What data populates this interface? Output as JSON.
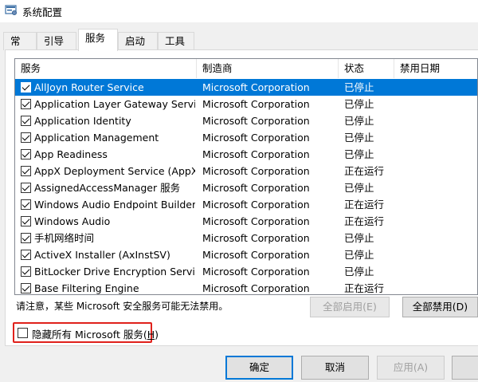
{
  "window": {
    "title": "系统配置"
  },
  "tabs": [
    {
      "label": "常规"
    },
    {
      "label": "引导"
    },
    {
      "label": "服务"
    },
    {
      "label": "启动"
    },
    {
      "label": "工具"
    }
  ],
  "active_tab": "服务",
  "columns": {
    "service": "服务",
    "manufacturer": "制造商",
    "status": "状态",
    "disabled_date": "禁用日期"
  },
  "services": [
    {
      "name": "AllJoyn Router Service",
      "manufacturer": "Microsoft Corporation",
      "status": "已停止",
      "disabled_date": "",
      "checked": true,
      "selected": true
    },
    {
      "name": "Application Layer Gateway Service",
      "manufacturer": "Microsoft Corporation",
      "status": "已停止",
      "disabled_date": "",
      "checked": true
    },
    {
      "name": "Application Identity",
      "manufacturer": "Microsoft Corporation",
      "status": "已停止",
      "disabled_date": "",
      "checked": true
    },
    {
      "name": "Application Management",
      "manufacturer": "Microsoft Corporation",
      "status": "已停止",
      "disabled_date": "",
      "checked": true
    },
    {
      "name": "App Readiness",
      "manufacturer": "Microsoft Corporation",
      "status": "已停止",
      "disabled_date": "",
      "checked": true
    },
    {
      "name": "AppX Deployment Service (AppX...",
      "manufacturer": "Microsoft Corporation",
      "status": "正在运行",
      "disabled_date": "",
      "checked": true
    },
    {
      "name": "AssignedAccessManager 服务",
      "manufacturer": "Microsoft Corporation",
      "status": "已停止",
      "disabled_date": "",
      "checked": true
    },
    {
      "name": "Windows Audio Endpoint Builder",
      "manufacturer": "Microsoft Corporation",
      "status": "正在运行",
      "disabled_date": "",
      "checked": true
    },
    {
      "name": "Windows Audio",
      "manufacturer": "Microsoft Corporation",
      "status": "正在运行",
      "disabled_date": "",
      "checked": true
    },
    {
      "name": "手机网络时间",
      "manufacturer": "Microsoft Corporation",
      "status": "已停止",
      "disabled_date": "",
      "checked": true
    },
    {
      "name": "ActiveX Installer (AxInstSV)",
      "manufacturer": "Microsoft Corporation",
      "status": "已停止",
      "disabled_date": "",
      "checked": true
    },
    {
      "name": "BitLocker Drive Encryption Service",
      "manufacturer": "Microsoft Corporation",
      "status": "已停止",
      "disabled_date": "",
      "checked": true
    },
    {
      "name": "Base Filtering Engine",
      "manufacturer": "Microsoft Corporation",
      "status": "正在运行",
      "disabled_date": "",
      "checked": true
    }
  ],
  "notice": "请注意，某些 Microsoft 安全服务可能无法禁用。",
  "buttons": {
    "enable_all": "全部启用(E)",
    "disable_all": "全部禁用(D)",
    "ok": "确定",
    "cancel": "取消",
    "apply": "应用(A)"
  },
  "hide_ms": {
    "label_prefix": "隐藏所有 Microsoft 服务(",
    "label_key": "H",
    "label_suffix": ")",
    "checked": false
  },
  "colors": {
    "selection": "#0078d7",
    "highlight_border": "#e0211b"
  }
}
